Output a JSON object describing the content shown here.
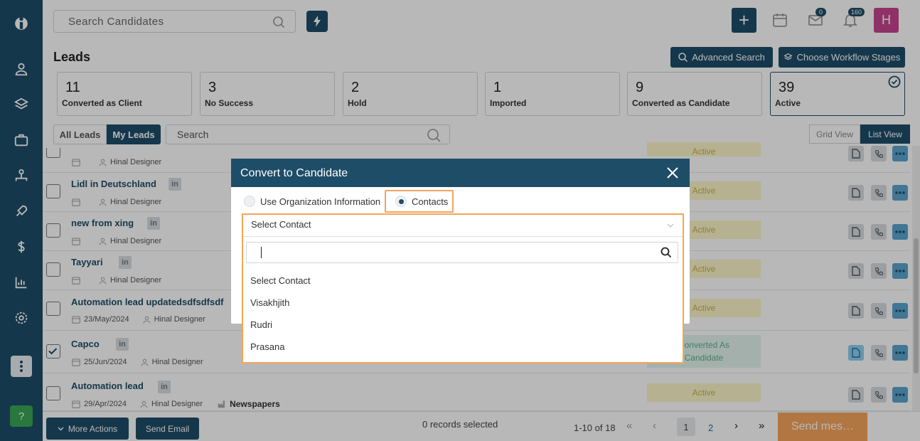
{
  "header": {
    "search_placeholder": "Search Candidates",
    "mail_count": "0",
    "notif_count": "160",
    "avatar_initial": "H"
  },
  "page": {
    "title": "Leads",
    "advanced_search": "Advanced Search",
    "workflow_stages": "Choose Workflow Stages"
  },
  "stats": [
    {
      "count": "11",
      "label": "Converted as Client"
    },
    {
      "count": "3",
      "label": "No Success"
    },
    {
      "count": "2",
      "label": "Hold"
    },
    {
      "count": "1",
      "label": "Imported"
    },
    {
      "count": "9",
      "label": "Converted as Candidate"
    },
    {
      "count": "39",
      "label": "Active"
    }
  ],
  "filters": {
    "all_leads": "All Leads",
    "my_leads": "My Leads",
    "search_placeholder": "Search",
    "grid_view": "Grid View",
    "list_view": "List View"
  },
  "rows": [
    {
      "name": "",
      "date": "",
      "owner": "Hinal Designer",
      "source": "",
      "status": "Active"
    },
    {
      "name": "Lidl in Deutschland",
      "date": "",
      "owner": "Hinal Designer",
      "source": "",
      "status": "Active"
    },
    {
      "name": "new from xing",
      "date": "",
      "owner": "Hinal Designer",
      "source": "",
      "status": "Active"
    },
    {
      "name": "Tayyari",
      "date": "",
      "owner": "Hinal Designer",
      "source": "",
      "status": "Active"
    },
    {
      "name": "Automation lead updatedsdfsdfsdf",
      "date": "23/May/2024",
      "owner": "Hinal Designer",
      "source": "",
      "status": "Active"
    },
    {
      "name": "Capco",
      "date": "25/Jun/2024",
      "owner": "Hinal Designer",
      "source": "",
      "status_line1": "Converted As",
      "status_line2": "Candidate"
    },
    {
      "name": "Automation lead",
      "date": "29/Apr/2024",
      "owner": "Hinal Designer",
      "source": "Newspapers",
      "status": "Active"
    }
  ],
  "footer": {
    "more_actions": "More Actions",
    "send_email": "Send Email",
    "records_selected": "0 records selected",
    "range": "1-10 of 18",
    "page1": "1",
    "page2": "2",
    "per_page": "10",
    "send_message": "Send mes…"
  },
  "modal": {
    "title": "Convert to Candidate",
    "radio_org": "Use Organization Information",
    "radio_contacts": "Contacts",
    "select_value": "Select Contact",
    "options": [
      "Select Contact",
      "Visakhjith",
      "Rudri",
      "Prasana"
    ]
  },
  "sidebar": {
    "help": "?"
  },
  "colors": {
    "primary": "#1e4d68",
    "highlight": "#f5a45b",
    "status_bg": "#fcf5c8",
    "status_text": "#c7b24a"
  }
}
